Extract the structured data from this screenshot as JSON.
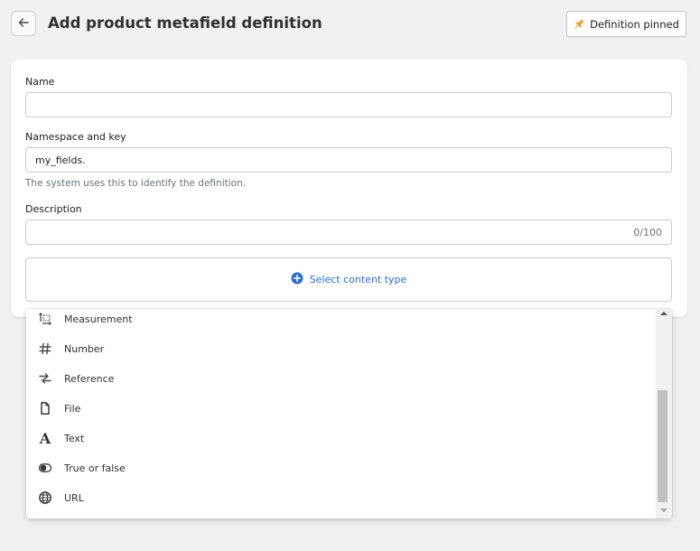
{
  "header": {
    "back_icon": "arrow-left-icon",
    "title": "Add product metafield definition",
    "pin_button": {
      "icon": "pin-icon",
      "label": "Definition pinned",
      "icon_color": "#e8a33a"
    }
  },
  "form": {
    "name": {
      "label": "Name",
      "value": ""
    },
    "namespace_key": {
      "label": "Namespace and key",
      "value": "my_fields.",
      "help": "The system uses this to identify the definition."
    },
    "description": {
      "label": "Description",
      "value": "",
      "counter": "0/100"
    },
    "content_type": {
      "icon": "plus-circle-icon",
      "label": "Select content type",
      "accent": "#2c6ecb"
    }
  },
  "dropdown": {
    "options": [
      {
        "label": "Measurement",
        "icon": "measurement-icon"
      },
      {
        "label": "Number",
        "icon": "hash-icon"
      },
      {
        "label": "Reference",
        "icon": "reference-arrows-icon"
      },
      {
        "label": "File",
        "icon": "file-icon"
      },
      {
        "label": "Text",
        "icon": "text-a-icon"
      },
      {
        "label": "True or false",
        "icon": "toggle-icon"
      },
      {
        "label": "URL",
        "icon": "globe-icon"
      }
    ]
  }
}
